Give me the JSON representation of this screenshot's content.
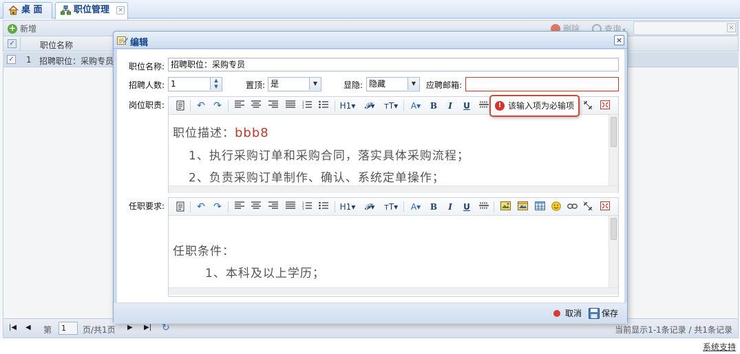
{
  "tabs": [
    {
      "label": "桌 面",
      "icon": "home-icon"
    },
    {
      "label": "职位管理",
      "icon": "org-chart-icon",
      "close": "×"
    }
  ],
  "toolbar": {
    "add_label": "新增",
    "delete_label": "删除",
    "query_label": "查询",
    "search_value": "",
    "clear_symbol": "×"
  },
  "grid": {
    "header_checkbox": "✓",
    "columns": [
      "职位名称"
    ],
    "rows": [
      {
        "checked": "✓",
        "index": "1",
        "name": "招聘职位：采购专员"
      }
    ]
  },
  "pager": {
    "first": "|◀",
    "prev": "◀",
    "page_prefix": "第",
    "page_value": "1",
    "page_suffix": "页/共1页",
    "next": "▶",
    "last": "▶|",
    "refresh": "↻",
    "status": "当前显示1-1条记录 / 共1条记录"
  },
  "footer": {
    "support_link": "系统支持"
  },
  "dialog": {
    "title": "编辑",
    "close": "×",
    "fields": {
      "name_label": "职位名称:",
      "name_value": "招聘职位：采购专员",
      "count_label": "招聘人数:",
      "count_value": "1",
      "top_label": "置顶:",
      "top_value": "是",
      "visible_label": "显隐:",
      "visible_value": "隐藏",
      "email_label": "应聘邮箱:",
      "email_value": "",
      "duty_label": "岗位职责:",
      "req_label": "任职要求:"
    },
    "validation_tip": "该输入项为必输项",
    "editor_duty": {
      "line1_prefix": "职位描述：",
      "line1_value": "bbb8",
      "line2": "1、执行采购订单和采购合同，落实具体采购流程；",
      "line3": "2、负责采购订单制作、确认、系统定单操作；"
    },
    "editor_req": {
      "line1": "任职条件：",
      "line2": "1、本科及以上学历；"
    },
    "toolbar_text": {
      "h1": "H1▾",
      "font": "𝓕▾",
      "size": "тT▾",
      "color": "A▾",
      "bold": "B",
      "italic": "I",
      "underline": "U"
    },
    "cancel_label": "取消",
    "save_label": "保存"
  },
  "colors": {
    "accent": "#15428b",
    "error": "#c9493a",
    "highlight_text": "#c0392b"
  }
}
